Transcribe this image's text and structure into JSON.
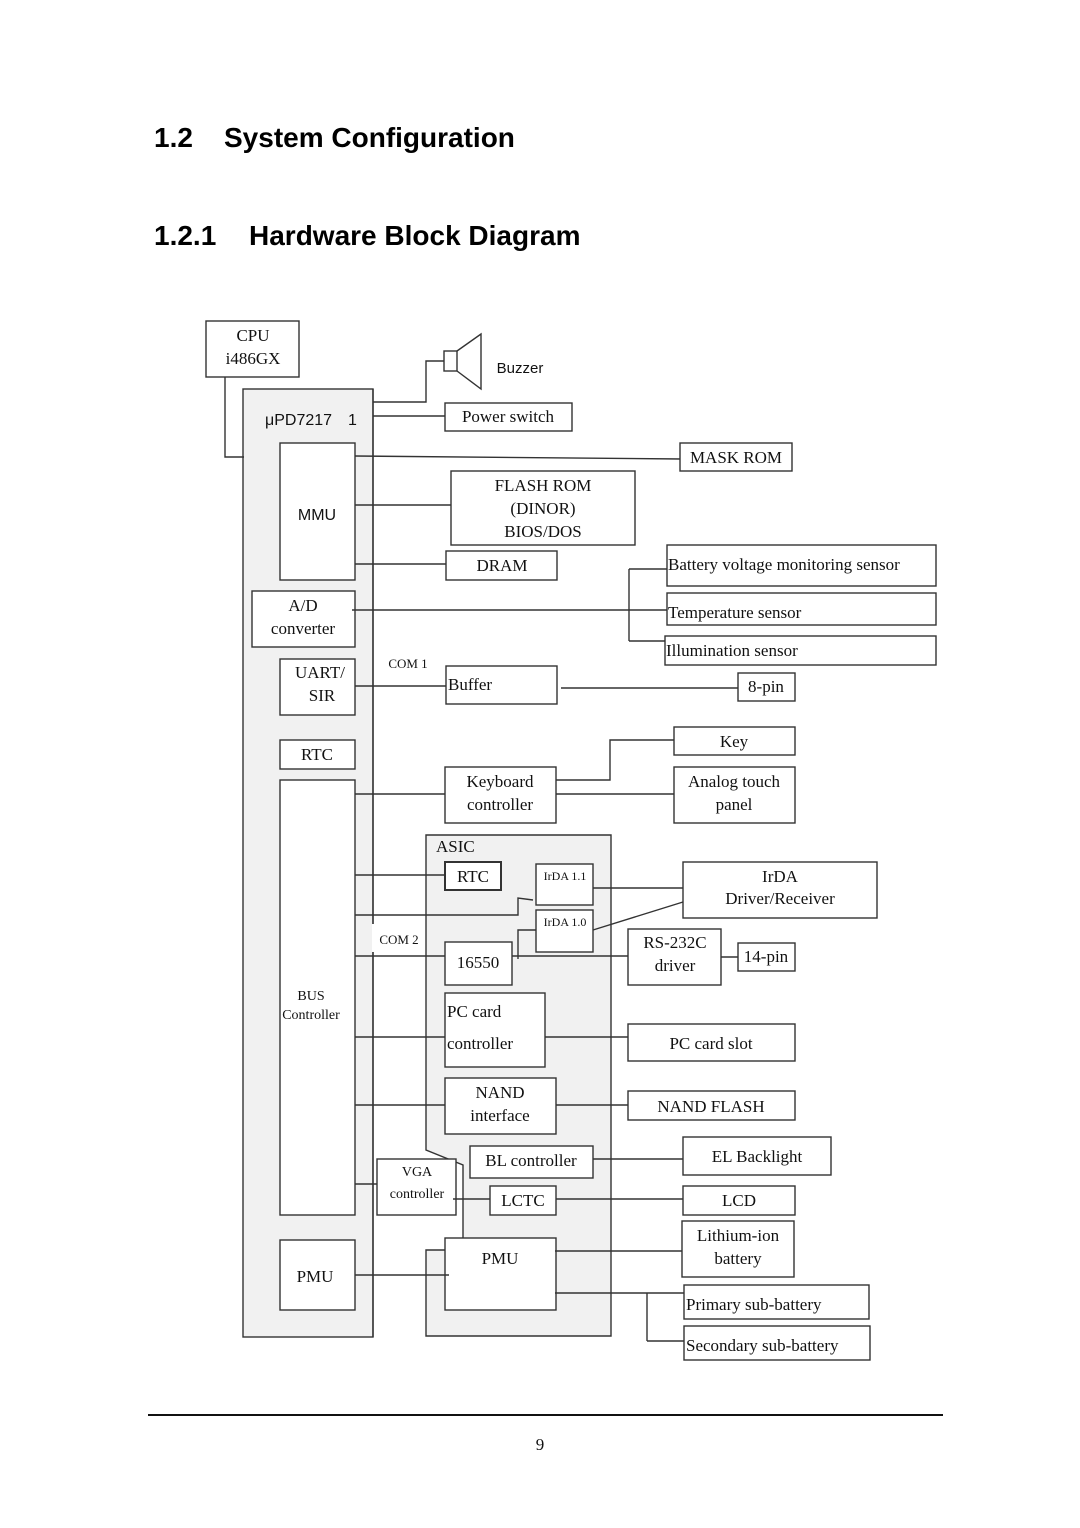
{
  "document": {
    "section": {
      "number": "1.2",
      "title": "System Configuration"
    },
    "subsection": {
      "number": "1.2.1",
      "title": "Hardware Block Diagram"
    },
    "page_number": "9"
  },
  "diagram": {
    "cpu": {
      "line1": "CPU",
      "line2": "i486GX"
    },
    "buzzer": "Buzzer",
    "power_switch": "Power switch",
    "upd_chip": "μPD7217　1",
    "mmu": "MMU",
    "mask_rom": "MASK ROM",
    "flash_rom": {
      "line1": "FLASH ROM",
      "line2": "(DINOR)",
      "line3": "BIOS/DOS"
    },
    "dram": "DRAM",
    "ad_converter": {
      "line1": "A/D",
      "line2": "converter"
    },
    "sensors": [
      "Battery voltage monitoring sensor",
      "Temperature sensor",
      "Illumination sensor"
    ],
    "com1": "COM 1",
    "uart": {
      "line1": "UART/",
      "line2": "SIR"
    },
    "buffer": "Buffer",
    "eight_pin": "8-pin",
    "rtc_left": "RTC",
    "key": "Key",
    "keyboard_controller": {
      "line1": "Keyboard",
      "line2": "controller"
    },
    "analog_touch": {
      "line1": "Analog touch",
      "line2": "panel"
    },
    "asic": "ASIC",
    "rtc_asic": "RTC",
    "irda11": "IrDA 1.1",
    "irda10": "IrDA 1.0",
    "irda_driver": {
      "line1": "IrDA",
      "line2": "Driver/Receiver"
    },
    "com2": "COM 2",
    "uart16550": "16550",
    "rs232c": {
      "line1": "RS-232C",
      "line2": "driver"
    },
    "fourteen_pin": "14-pin",
    "bus_controller": {
      "line1": "BUS",
      "line2": "Controller"
    },
    "pc_card_controller": {
      "line1": "PC card",
      "line2": "controller"
    },
    "pc_card_slot": "PC card slot",
    "nand_interface": {
      "line1": "NAND",
      "line2": "interface"
    },
    "nand_flash": "NAND FLASH",
    "bl_controller": "BL controller",
    "el_backlight": "EL Backlight",
    "vga_controller": {
      "line1": "VGA",
      "line2": "controller"
    },
    "lctc": "LCTC",
    "lcd": "LCD",
    "pmu_left": "PMU",
    "pmu_asic": "PMU",
    "lithium": {
      "line1": "Lithium-ion",
      "line2": "battery"
    },
    "primary_sub": "Primary sub-battery",
    "secondary_sub": "Secondary sub-battery"
  }
}
